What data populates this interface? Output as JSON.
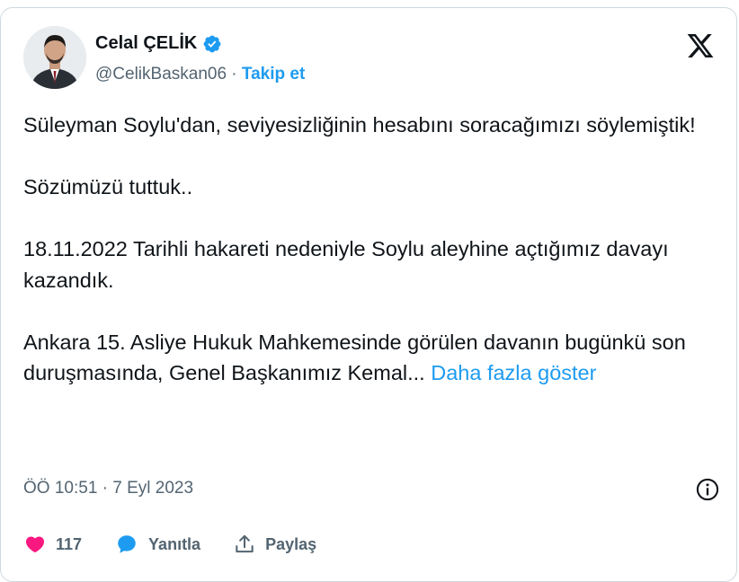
{
  "author": {
    "display_name": "Celal ÇELİK",
    "handle": "@CelikBaskan06",
    "separator": " · ",
    "follow_label": "Takip et"
  },
  "tweet": {
    "paragraphs": [
      "Süleyman Soylu'dan, seviyesizliğinin hesabını soracağımızı söylemiştik!",
      "Sözümüzü tuttuk..",
      "18.11.2022 Tarihli hakareti nedeniyle Soylu aleyhine açtığımız davayı kazandık."
    ],
    "last_paragraph": "Ankara 15. Asliye Hukuk Mahkemesinde görülen davanın bugünkü son duruşmasında, Genel Başkanımız Kemal...",
    "show_more": "Daha fazla göster"
  },
  "meta": {
    "time": "ÖÖ 10:51",
    "separator": " · ",
    "date": "7 Eyl 2023"
  },
  "actions": {
    "likes": "117",
    "reply_label": "Yanıtla",
    "share_label": "Paylaş"
  },
  "icons": {
    "verified": "verified-badge-icon",
    "brand": "x-logo-icon",
    "info": "info-icon",
    "like": "heart-icon",
    "reply": "speech-bubble-icon",
    "share": "share-upload-icon"
  },
  "colors": {
    "accent": "#1d9bf0",
    "like": "#f91880",
    "muted": "#536471",
    "text": "#0f1419",
    "border": "#cfd9de"
  }
}
